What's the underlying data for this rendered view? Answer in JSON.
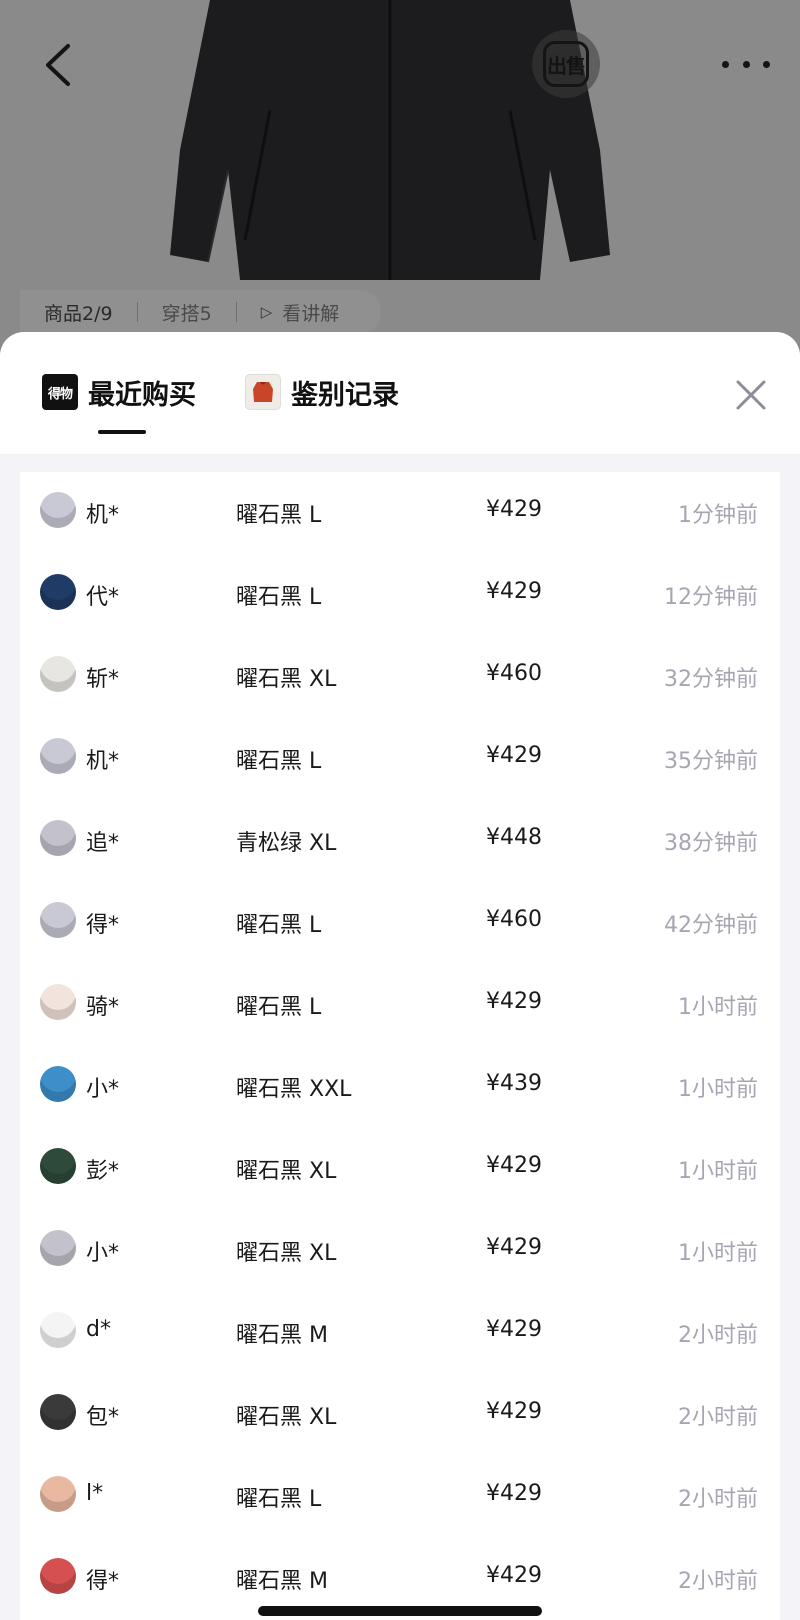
{
  "header": {
    "back_icon": "chevron-left-icon",
    "sell_badge": "出售",
    "more_icon": "more-dots-icon"
  },
  "media_bar": {
    "product_counter": "商品2/9",
    "outfits": "穿搭5",
    "watch_explain": "看讲解"
  },
  "sheet": {
    "tabs": [
      {
        "label": "最近购买",
        "icon_text": "得物",
        "active": true
      },
      {
        "label": "鉴别记录",
        "icon": "jacket-thumbnail-icon",
        "active": false
      }
    ],
    "close_icon": "close-icon"
  },
  "purchases": [
    {
      "user": "机*",
      "variant": "曜石黑 L",
      "price": "¥429",
      "time": "1分钟前",
      "avatar_color": "#c9c9d6"
    },
    {
      "user": "代*",
      "variant": "曜石黑 L",
      "price": "¥429",
      "time": "12分钟前",
      "avatar_color": "#1f3b66"
    },
    {
      "user": "斩*",
      "variant": "曜石黑 XL",
      "price": "¥460",
      "time": "32分钟前",
      "avatar_color": "#e8e6e1"
    },
    {
      "user": "机*",
      "variant": "曜石黑 L",
      "price": "¥429",
      "time": "35分钟前",
      "avatar_color": "#c9c9d6"
    },
    {
      "user": "追*",
      "variant": "青松绿 XL",
      "price": "¥448",
      "time": "38分钟前",
      "avatar_color": "#c3c2cc"
    },
    {
      "user": "得*",
      "variant": "曜石黑 L",
      "price": "¥460",
      "time": "42分钟前",
      "avatar_color": "#c9c9d6"
    },
    {
      "user": "骑*",
      "variant": "曜石黑 L",
      "price": "¥429",
      "time": "1小时前",
      "avatar_color": "#f2e4dc"
    },
    {
      "user": "小*",
      "variant": "曜石黑 XXL",
      "price": "¥439",
      "time": "1小时前",
      "avatar_color": "#3e8fc9"
    },
    {
      "user": "彭*",
      "variant": "曜石黑 XL",
      "price": "¥429",
      "time": "1小时前",
      "avatar_color": "#2d4a3a"
    },
    {
      "user": "小*",
      "variant": "曜石黑 XL",
      "price": "¥429",
      "time": "1小时前",
      "avatar_color": "#c3c2cc"
    },
    {
      "user": "d*",
      "variant": "曜石黑 M",
      "price": "¥429",
      "time": "2小时前",
      "avatar_color": "#f4f4f4"
    },
    {
      "user": "包*",
      "variant": "曜石黑 XL",
      "price": "¥429",
      "time": "2小时前",
      "avatar_color": "#3a3a3a"
    },
    {
      "user": "l*",
      "variant": "曜石黑 L",
      "price": "¥429",
      "time": "2小时前",
      "avatar_color": "#e9b8a0"
    },
    {
      "user": "得*",
      "variant": "曜石黑 M",
      "price": "¥429",
      "time": "2小时前",
      "avatar_color": "#d65050"
    }
  ]
}
